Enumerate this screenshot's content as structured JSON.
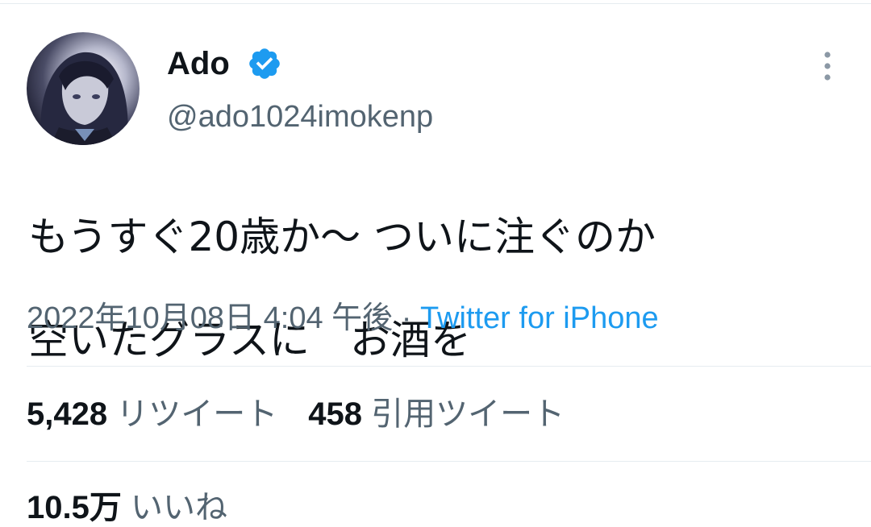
{
  "author": {
    "display_name": "Ado",
    "handle": "@ado1024imokenp",
    "verified": true,
    "avatar_icon": "avatar-image"
  },
  "tweet": {
    "text_line1": "もうすぐ20歳か〜 ついに注ぐのか",
    "text_line2": "空いたグラスに　お酒を",
    "timestamp": "2022年10月08日 4:04 午後",
    "separator": " · ",
    "source": "Twitter for iPhone"
  },
  "stats": {
    "retweets_count": "5,428",
    "retweets_label": "リツイート",
    "quotes_count": "458",
    "quotes_label": "引用ツイート",
    "likes_count": "10.5万",
    "likes_label": "いいね"
  },
  "colors": {
    "accent": "#1d9bf0",
    "secondary_text": "#536471",
    "primary_text": "#0f1419",
    "divider": "#e6ecf0"
  },
  "icons": [
    "verified-badge-icon",
    "more-options-icon"
  ]
}
